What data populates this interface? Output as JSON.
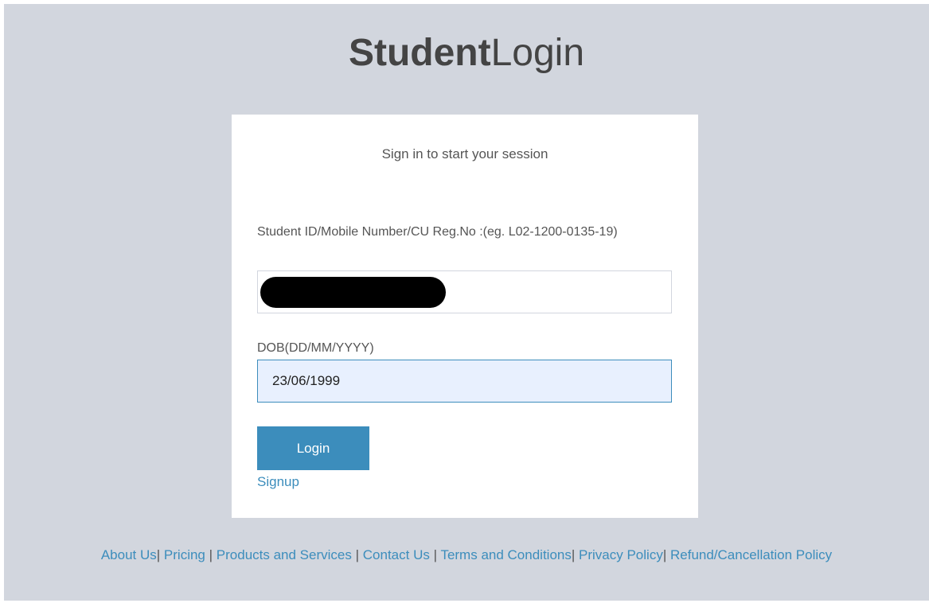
{
  "header": {
    "title_bold": "Student",
    "title_light": "Login"
  },
  "login_box": {
    "subtitle": "Sign in to start your session",
    "id_label": "Student ID/Mobile Number/CU Reg.No :(eg. L02-1200-0135-19)",
    "id_value": "",
    "dob_label": "DOB(DD/MM/YYYY)",
    "dob_value": "23/06/1999",
    "login_button": "Login",
    "signup_link": "Signup"
  },
  "footer": {
    "links": [
      "About Us",
      "Pricing",
      "Products and Services",
      "Contact Us",
      "Terms and Conditions",
      "Privacy Policy",
      "Refund/Cancellation Policy"
    ],
    "separator": "|"
  },
  "colors": {
    "page_background": "#d2d6de",
    "card_background": "#ffffff",
    "accent": "#3c8dbc",
    "autofill_background": "#e8f0fe",
    "title_text": "#444444"
  }
}
